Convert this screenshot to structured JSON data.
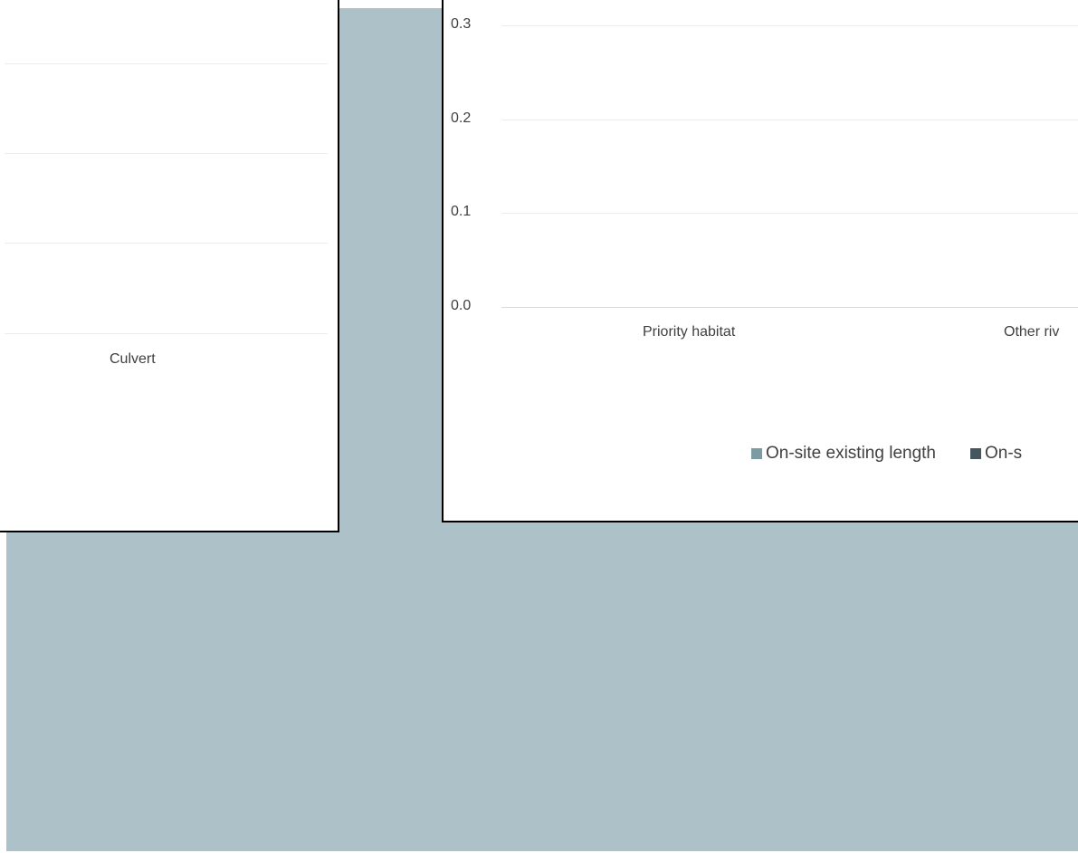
{
  "colors": {
    "backdrop": "#acc2c8",
    "series_existing": "#7c9ba3",
    "series_other": "#45575c"
  },
  "left_chart": {
    "category_label": "Culvert"
  },
  "chart_data": {
    "type": "bar",
    "categories": [
      "Priority habitat",
      "Other riv"
    ],
    "series": [
      {
        "name": "On-site existing length",
        "values": [
          0,
          0
        ]
      },
      {
        "name": "On-s",
        "values": [
          0,
          0
        ]
      }
    ],
    "yticks": [
      "0.3",
      "0.2",
      "0.1",
      "0.0"
    ],
    "ylim": [
      0,
      0.3
    ],
    "grid": true,
    "legend_position": "bottom"
  }
}
